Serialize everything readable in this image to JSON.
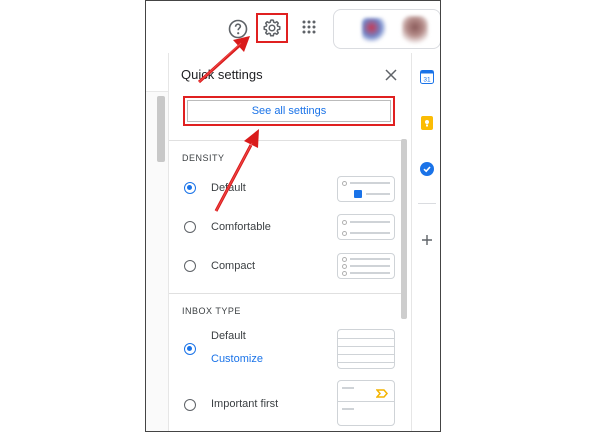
{
  "panel": {
    "title": "Quick settings",
    "see_all_label": "See all settings"
  },
  "density": {
    "heading": "DENSITY",
    "options": [
      {
        "label": "Default",
        "selected": true
      },
      {
        "label": "Comfortable",
        "selected": false
      },
      {
        "label": "Compact",
        "selected": false
      }
    ]
  },
  "inbox_type": {
    "heading": "INBOX TYPE",
    "options": [
      {
        "label": "Default",
        "selected": true,
        "link": "Customize"
      },
      {
        "label": "Important first",
        "selected": false
      }
    ]
  },
  "topbar": {
    "icons": [
      "help-icon",
      "gear-icon",
      "apps-icon"
    ],
    "account_area": "blurred-account-images"
  },
  "side_rail": {
    "icons": [
      "calendar-icon",
      "keep-icon",
      "tasks-icon",
      "add-icon"
    ],
    "calendar_day": "31"
  },
  "colors": {
    "accent": "#1a73e8",
    "highlight": "#e02020",
    "keep": "#fbbc04",
    "important": "#f4b400"
  }
}
